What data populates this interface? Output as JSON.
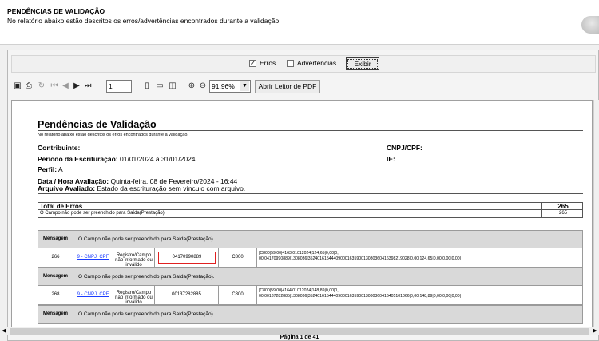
{
  "header": {
    "title": "PENDÊNCIAS DE VALIDAÇÃO",
    "description": "No relatório abaixo estão descritos os erros/advertências encontrados durante a validação."
  },
  "filters": {
    "errors_label": "Erros",
    "errors_checked": true,
    "warnings_label": "Advertências",
    "warnings_checked": false,
    "show_button": "Exibir"
  },
  "toolbar": {
    "page": "1",
    "zoom": "91,96%",
    "open_pdf_button": "Abrir Leitor de PDF",
    "icons": [
      "save-icon",
      "print-icon",
      "refresh-icon",
      "first-page-icon",
      "prev-page-icon",
      "next-page-icon",
      "last-page-icon",
      "single-page-icon",
      "page-width-icon",
      "multi-page-icon",
      "zoom-in-icon",
      "zoom-out-icon"
    ]
  },
  "report": {
    "title": "Pendências de Validação",
    "description": "No relatório abaixo estão descritos os erros encontrados durante a validação.",
    "contribuinte_label": "Contribuinte:",
    "contribuinte_value": "",
    "cnpj_label": "CNPJ/CPF:",
    "ie_label": "IE:",
    "periodo_label": "Período da Escrituração:",
    "periodo_value": "01/01/2024 à 31/01/2024",
    "perfil_label": "Perfil:",
    "perfil_value": "A",
    "data_label": "Data / Hora Avaliação:",
    "data_value": "Quinta-feira, 08 de Fevereiro/2024 - 16:44",
    "arquivo_label": "Arquivo Avaliado:",
    "arquivo_value": "Estado da escrituração sem vínculo com arquivo.",
    "totals": {
      "header_label": "Total de Erros",
      "header_value": "265",
      "rows": [
        {
          "label": "O Campo não pode ser preenchido para Saída(Prestação).",
          "value": "265"
        }
      ]
    },
    "messages": [
      {
        "tag": "Mensagem",
        "text": "O Campo não pode ser preenchido para Saída(Prestação).",
        "row": {
          "num": "266",
          "field": "9 - CNPJ_CPF",
          "desc": "Registro/Campo não informado ou inválido",
          "value": "04170990889",
          "register": "C800",
          "line1": "|C800|59|00|4163|01012024|124,65|0,00|0,",
          "line2": "00|04170990889|1308036|35240161544409000163590013080360416398219028|0,00|124,65|0,00|0,00|0,00|"
        }
      },
      {
        "tag": "Mensagem",
        "text": "O Campo não pode ser preenchido para Saída(Prestação).",
        "row": {
          "num": "268",
          "field": "9 - CNPJ_CPF",
          "desc": "Registro/Campo não informado ou inválido",
          "value": "00137282885",
          "register": "C800",
          "line1": "|C800|59|00|4164|01012024|148,89|0,00|0,",
          "line2": "00|00137282885|1308036|35240161544409000163590013080360416405101066|0,00|148,89|0,00|0,00|0,00|"
        }
      },
      {
        "tag": "Mensagem",
        "text": "O Campo não pode ser preenchido para Saída(Prestação)."
      }
    ]
  },
  "footer": {
    "page_indicator": "Página 1 de 41"
  }
}
